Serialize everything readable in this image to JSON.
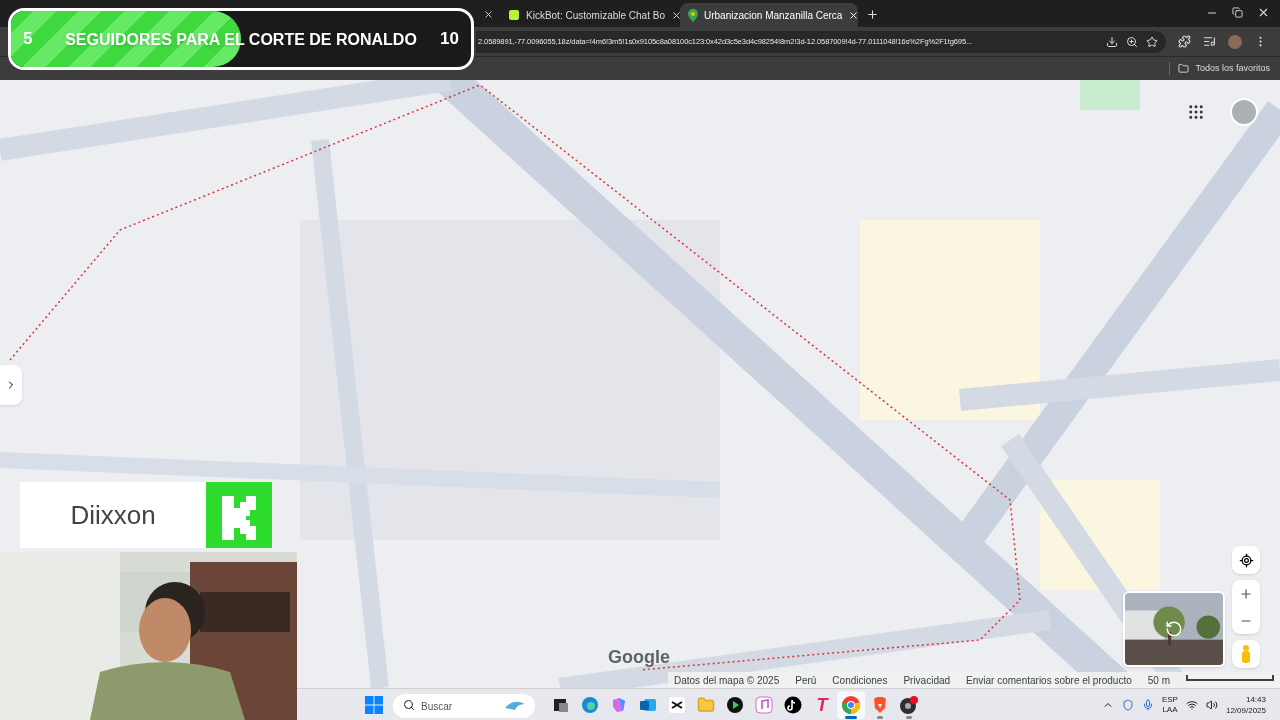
{
  "browser": {
    "tabs": [
      {
        "title": "KickBot: Customizable Chat Bo",
        "kind": "bot",
        "selected": false
      },
      {
        "title": "Urbanizacion Manzanilla Cerca",
        "kind": "map",
        "selected": true
      }
    ],
    "url": "2.0589891,-77.0096055,18z/data=!4m6!3m5!1s0x9105c8a08100c123:0x42d3c5e3d4c98254!8m2!3d-12.0587009!4d-77.0111048!16s%2Fg%2F1tg695...",
    "bookmarks": [
      {
        "label": "Todos los favoritos"
      }
    ]
  },
  "map": {
    "logo": "Google",
    "footer": {
      "links": [
        "Datos del mapa © 2025",
        "Perú",
        "Condiciones",
        "Privacidad",
        "Enviar comentarios sobre el producto"
      ],
      "scale": "50 m"
    }
  },
  "taskbar": {
    "search_placeholder": "Buscar",
    "apps": [
      {
        "kind": "taskview",
        "running": false,
        "selected": false
      },
      {
        "kind": "edge",
        "running": false,
        "selected": false
      },
      {
        "kind": "copilot",
        "running": false,
        "selected": false
      },
      {
        "kind": "outlook",
        "running": false,
        "selected": false
      },
      {
        "kind": "capcut",
        "running": false,
        "selected": false
      },
      {
        "kind": "explorer",
        "running": false,
        "selected": false
      },
      {
        "kind": "player",
        "running": false,
        "selected": false
      },
      {
        "kind": "music",
        "running": false,
        "selected": false
      },
      {
        "kind": "tiktok",
        "running": false,
        "selected": false
      },
      {
        "kind": "letter",
        "label": "T",
        "running": false,
        "selected": false
      },
      {
        "kind": "chrome",
        "running": true,
        "selected": true
      },
      {
        "kind": "brave",
        "running": true,
        "selected": false
      },
      {
        "kind": "obs",
        "running": true,
        "selected": false
      }
    ],
    "tray": {
      "language": "ESP",
      "layout": "LAA",
      "time": "14:43",
      "date": "12/09/2025"
    }
  },
  "stream_overlay": {
    "goal": {
      "current": "5",
      "title": "SEGUIDORES PARA EL CORTE DE RONALDO",
      "target": "10",
      "level": 0.5
    },
    "streamer": {
      "name": "Diixxon"
    }
  }
}
